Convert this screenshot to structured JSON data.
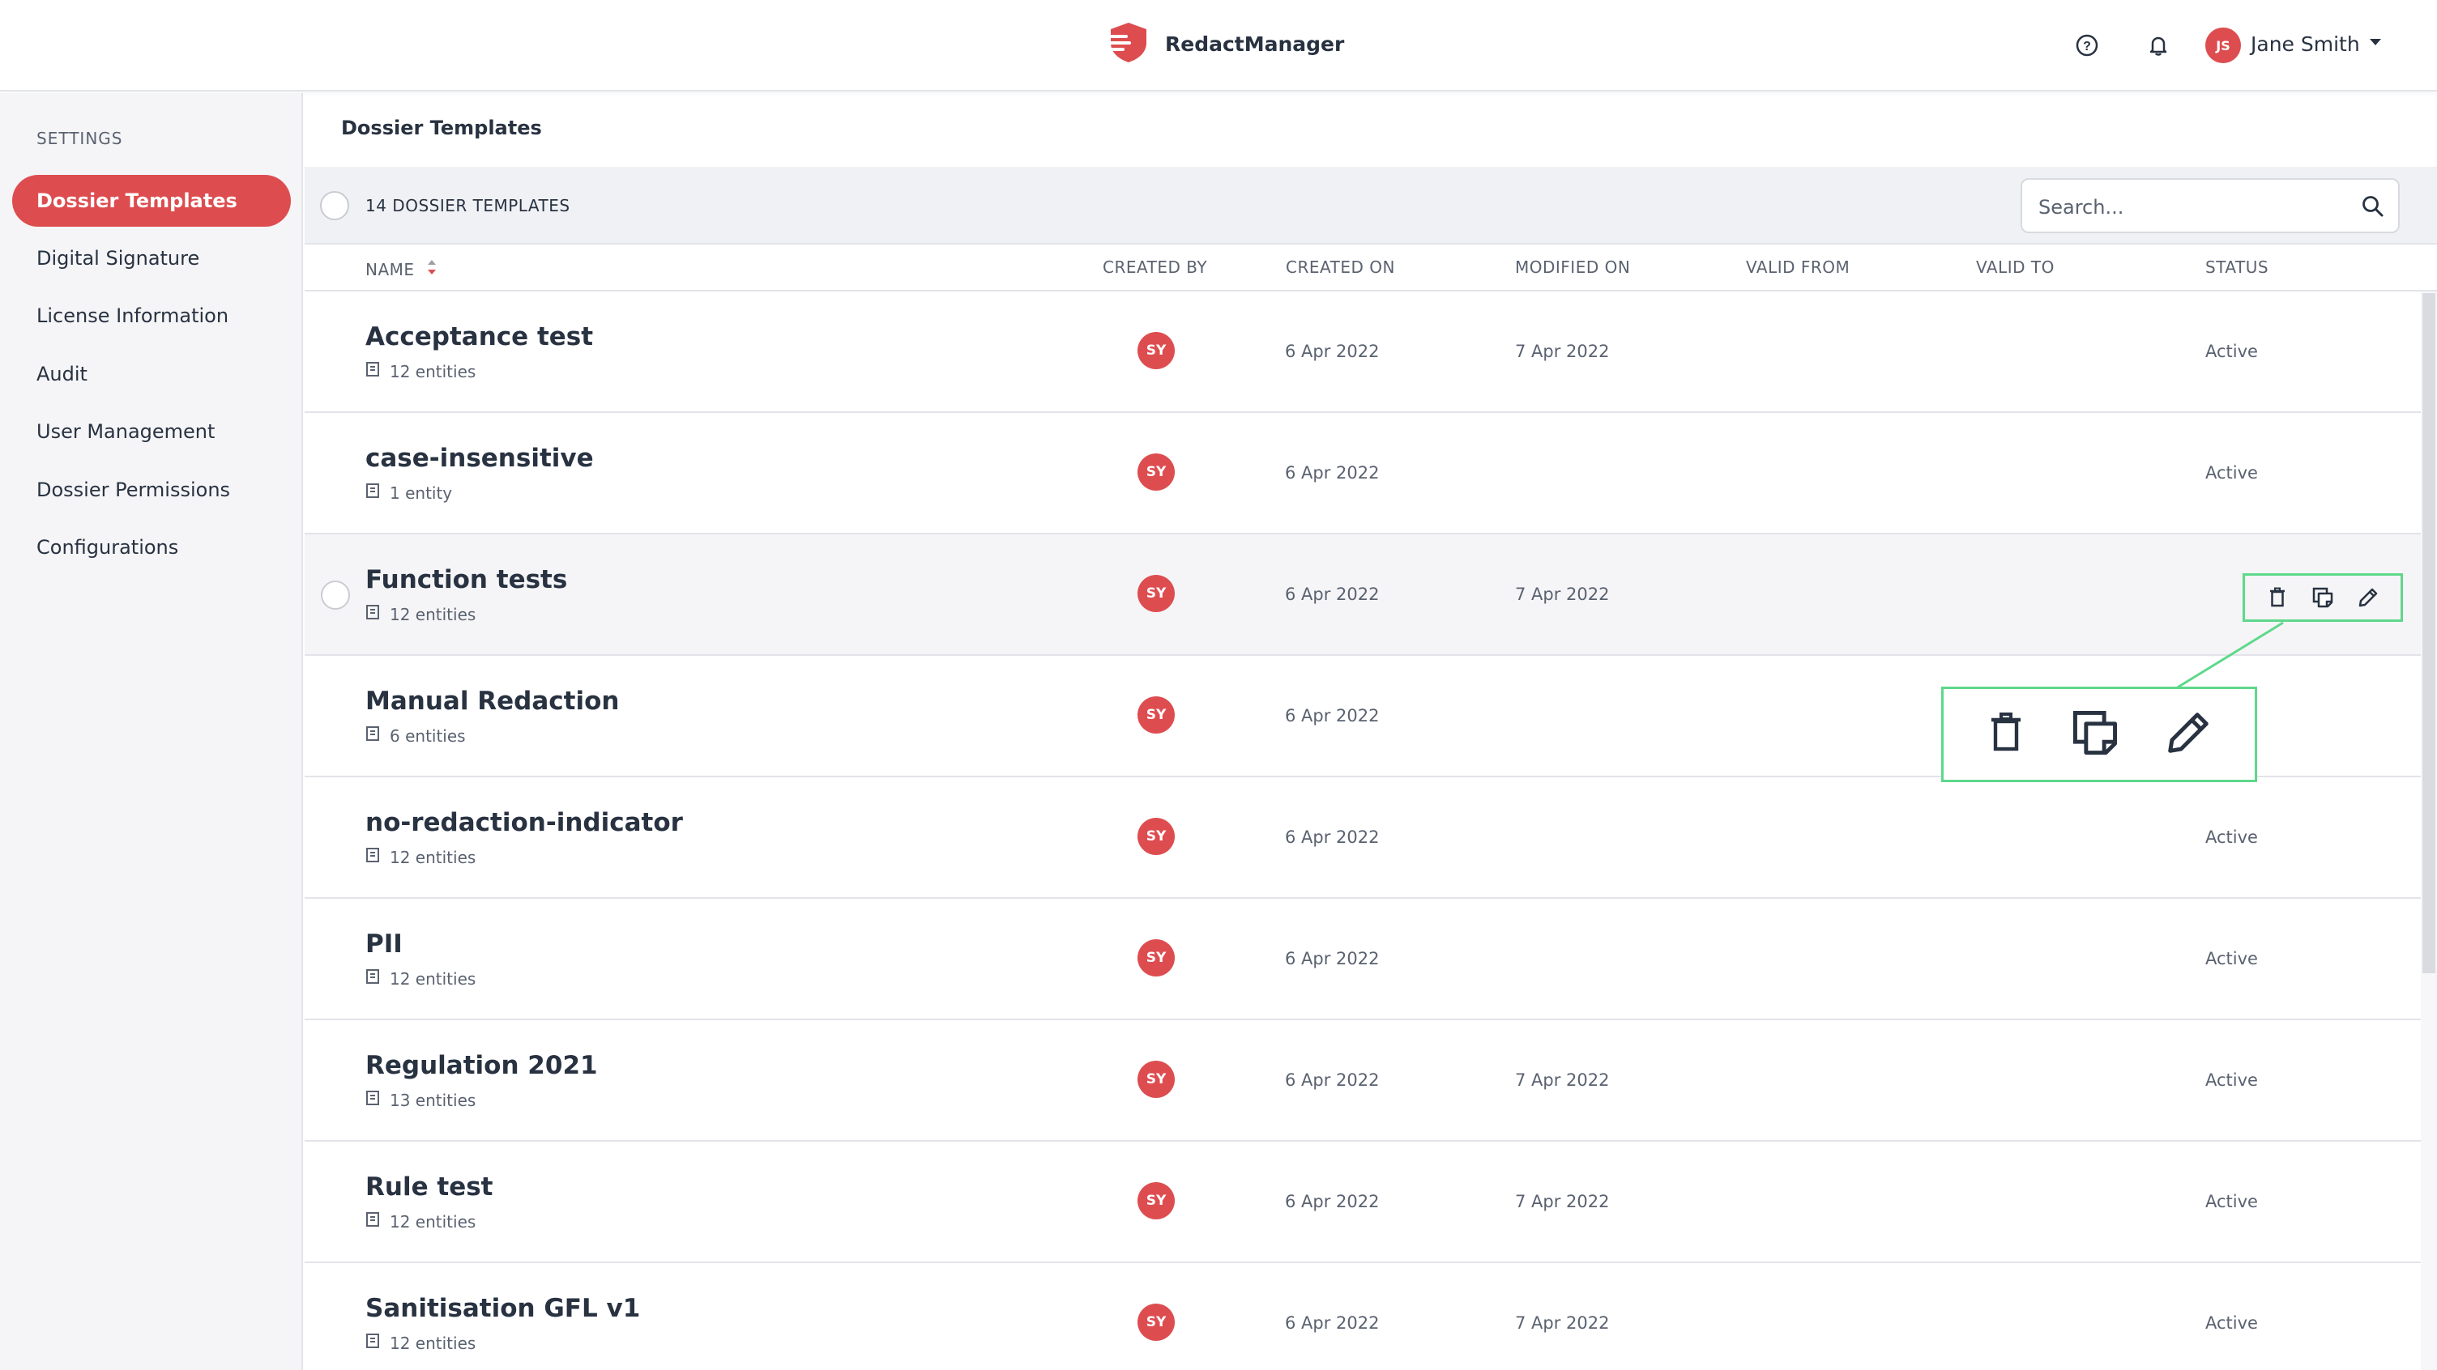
{
  "header": {
    "app_name": "RedactManager",
    "user": {
      "initials": "JS",
      "name": "Jane Smith"
    },
    "icons": [
      "help-icon",
      "bell-icon",
      "caret-down-icon"
    ]
  },
  "sidebar": {
    "heading": "SETTINGS",
    "items": [
      {
        "label": "Dossier Templates",
        "active": true
      },
      {
        "label": "Digital Signature"
      },
      {
        "label": "License Information"
      },
      {
        "label": "Audit"
      },
      {
        "label": "User Management"
      },
      {
        "label": "Dossier Permissions"
      },
      {
        "label": "Configurations"
      }
    ]
  },
  "main": {
    "title": "Dossier Templates",
    "count_label": "14 DOSSIER TEMPLATES",
    "search_placeholder": "Search...",
    "columns": {
      "name": "NAME",
      "created_by": "CREATED BY",
      "created_on": "CREATED ON",
      "modified_on": "MODIFIED ON",
      "valid_from": "VALID FROM",
      "valid_to": "VALID TO",
      "status": "STATUS"
    },
    "rows": [
      {
        "name": "Acceptance test",
        "entities": "12 entities",
        "created_by": "SY",
        "created_on": "6 Apr 2022",
        "modified_on": "7 Apr 2022",
        "status": "Active"
      },
      {
        "name": "case-insensitive",
        "entities": "1 entity",
        "created_by": "SY",
        "created_on": "6 Apr 2022",
        "modified_on": "",
        "status": "Active"
      },
      {
        "name": "Function tests",
        "entities": "12 entities",
        "created_by": "SY",
        "created_on": "6 Apr 2022",
        "modified_on": "7 Apr 2022",
        "status": "",
        "hovered": true
      },
      {
        "name": "Manual Redaction",
        "entities": "6 entities",
        "created_by": "SY",
        "created_on": "6 Apr 2022",
        "modified_on": "",
        "status": ""
      },
      {
        "name": "no-redaction-indicator",
        "entities": "12 entities",
        "created_by": "SY",
        "created_on": "6 Apr 2022",
        "modified_on": "",
        "status": "Active"
      },
      {
        "name": "PII",
        "entities": "12 entities",
        "created_by": "SY",
        "created_on": "6 Apr 2022",
        "modified_on": "",
        "status": "Active"
      },
      {
        "name": "Regulation 2021",
        "entities": "13 entities",
        "created_by": "SY",
        "created_on": "6 Apr 2022",
        "modified_on": "7 Apr 2022",
        "status": "Active"
      },
      {
        "name": "Rule test",
        "entities": "12 entities",
        "created_by": "SY",
        "created_on": "6 Apr 2022",
        "modified_on": "7 Apr 2022",
        "status": "Active"
      },
      {
        "name": "Sanitisation GFL v1",
        "entities": "12 entities",
        "created_by": "SY",
        "created_on": "6 Apr 2022",
        "modified_on": "7 Apr 2022",
        "status": "Active"
      }
    ],
    "row_actions": [
      "trash-icon",
      "copy-icon",
      "pencil-icon"
    ]
  },
  "colors": {
    "accent": "#dd4d50",
    "highlight": "#5ed88b",
    "sidebar_bg": "#f5f5f7"
  }
}
